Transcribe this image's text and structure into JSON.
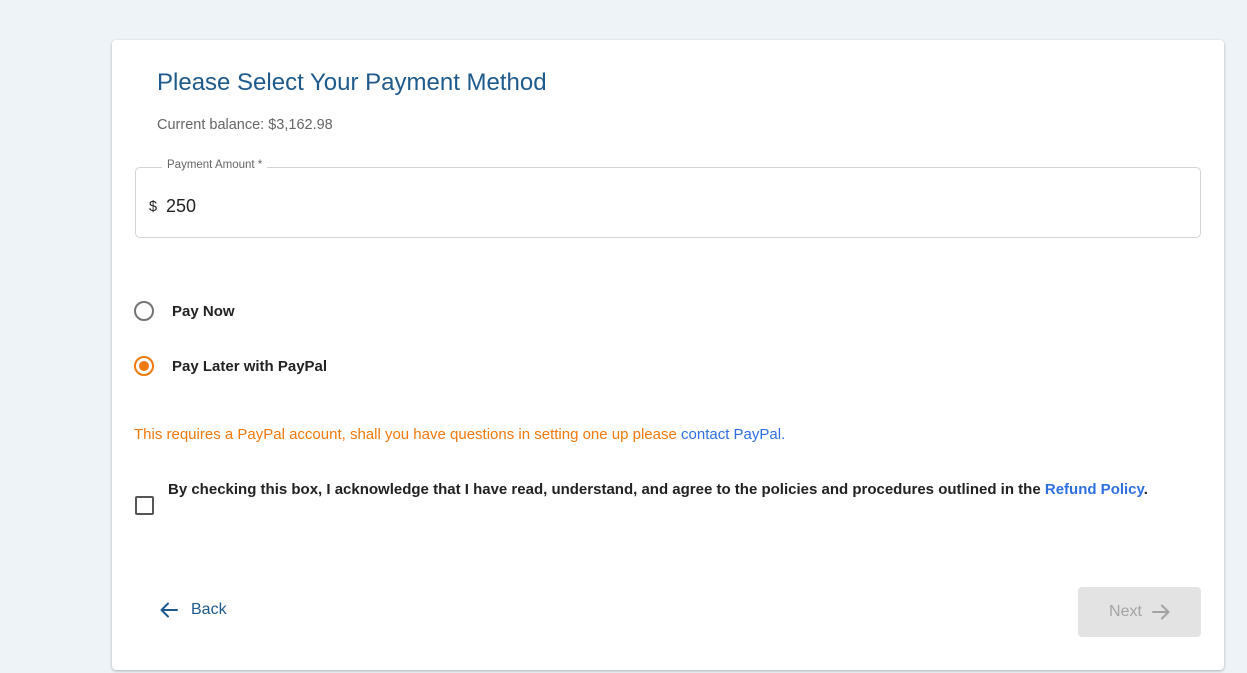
{
  "page": {
    "title": "Please Select Your Payment Method",
    "current_balance": "Current balance: $3,162.98"
  },
  "payment_amount": {
    "label": "Payment Amount *",
    "currency_symbol": "$",
    "value": "250"
  },
  "payment_options": [
    {
      "label": "Pay Now",
      "selected": false
    },
    {
      "label": "Pay Later with PayPal",
      "selected": true
    }
  ],
  "paypal_note": {
    "text": "This requires a PayPal account, shall you have questions in setting one up please ",
    "link_text": "contact PayPal",
    "suffix": "."
  },
  "agreement": {
    "checked": false,
    "text": "By checking this box, I acknowledge that I have read, understand, and agree to the policies and procedures outlined in the ",
    "link_text": "Refund Policy",
    "suffix": "."
  },
  "navigation": {
    "back_label": "Back",
    "next_label": "Next",
    "next_disabled": true
  },
  "colors": {
    "title": "#1e5a8c",
    "accent_orange": "#f2790d",
    "link_blue": "#2f6fe0",
    "background": "#edf3f7",
    "disabled_button": "#e3e3e3"
  },
  "icons": {
    "back": "arrow-left-icon",
    "next": "arrow-right-icon"
  }
}
